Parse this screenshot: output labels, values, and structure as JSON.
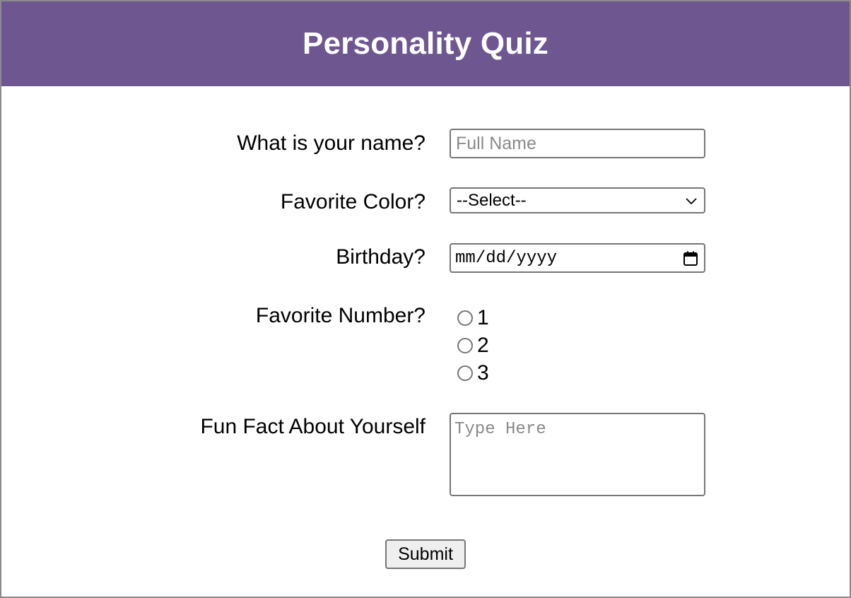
{
  "header": {
    "title": "Personality Quiz",
    "background_color": "#6e5791"
  },
  "form": {
    "name": {
      "label": "What is your name?",
      "placeholder": "Full Name",
      "value": ""
    },
    "color": {
      "label": "Favorite Color?",
      "selected": "--Select--"
    },
    "birthday": {
      "label": "Birthday?",
      "value": "mm/dd/yyyy"
    },
    "number": {
      "label": "Favorite Number?",
      "options": [
        {
          "label": "1",
          "checked": false
        },
        {
          "label": "2",
          "checked": false
        },
        {
          "label": "3",
          "checked": false
        }
      ]
    },
    "fun_fact": {
      "label": "Fun Fact About Yourself",
      "placeholder": "Type Here",
      "value": ""
    },
    "submit_label": "Submit"
  }
}
